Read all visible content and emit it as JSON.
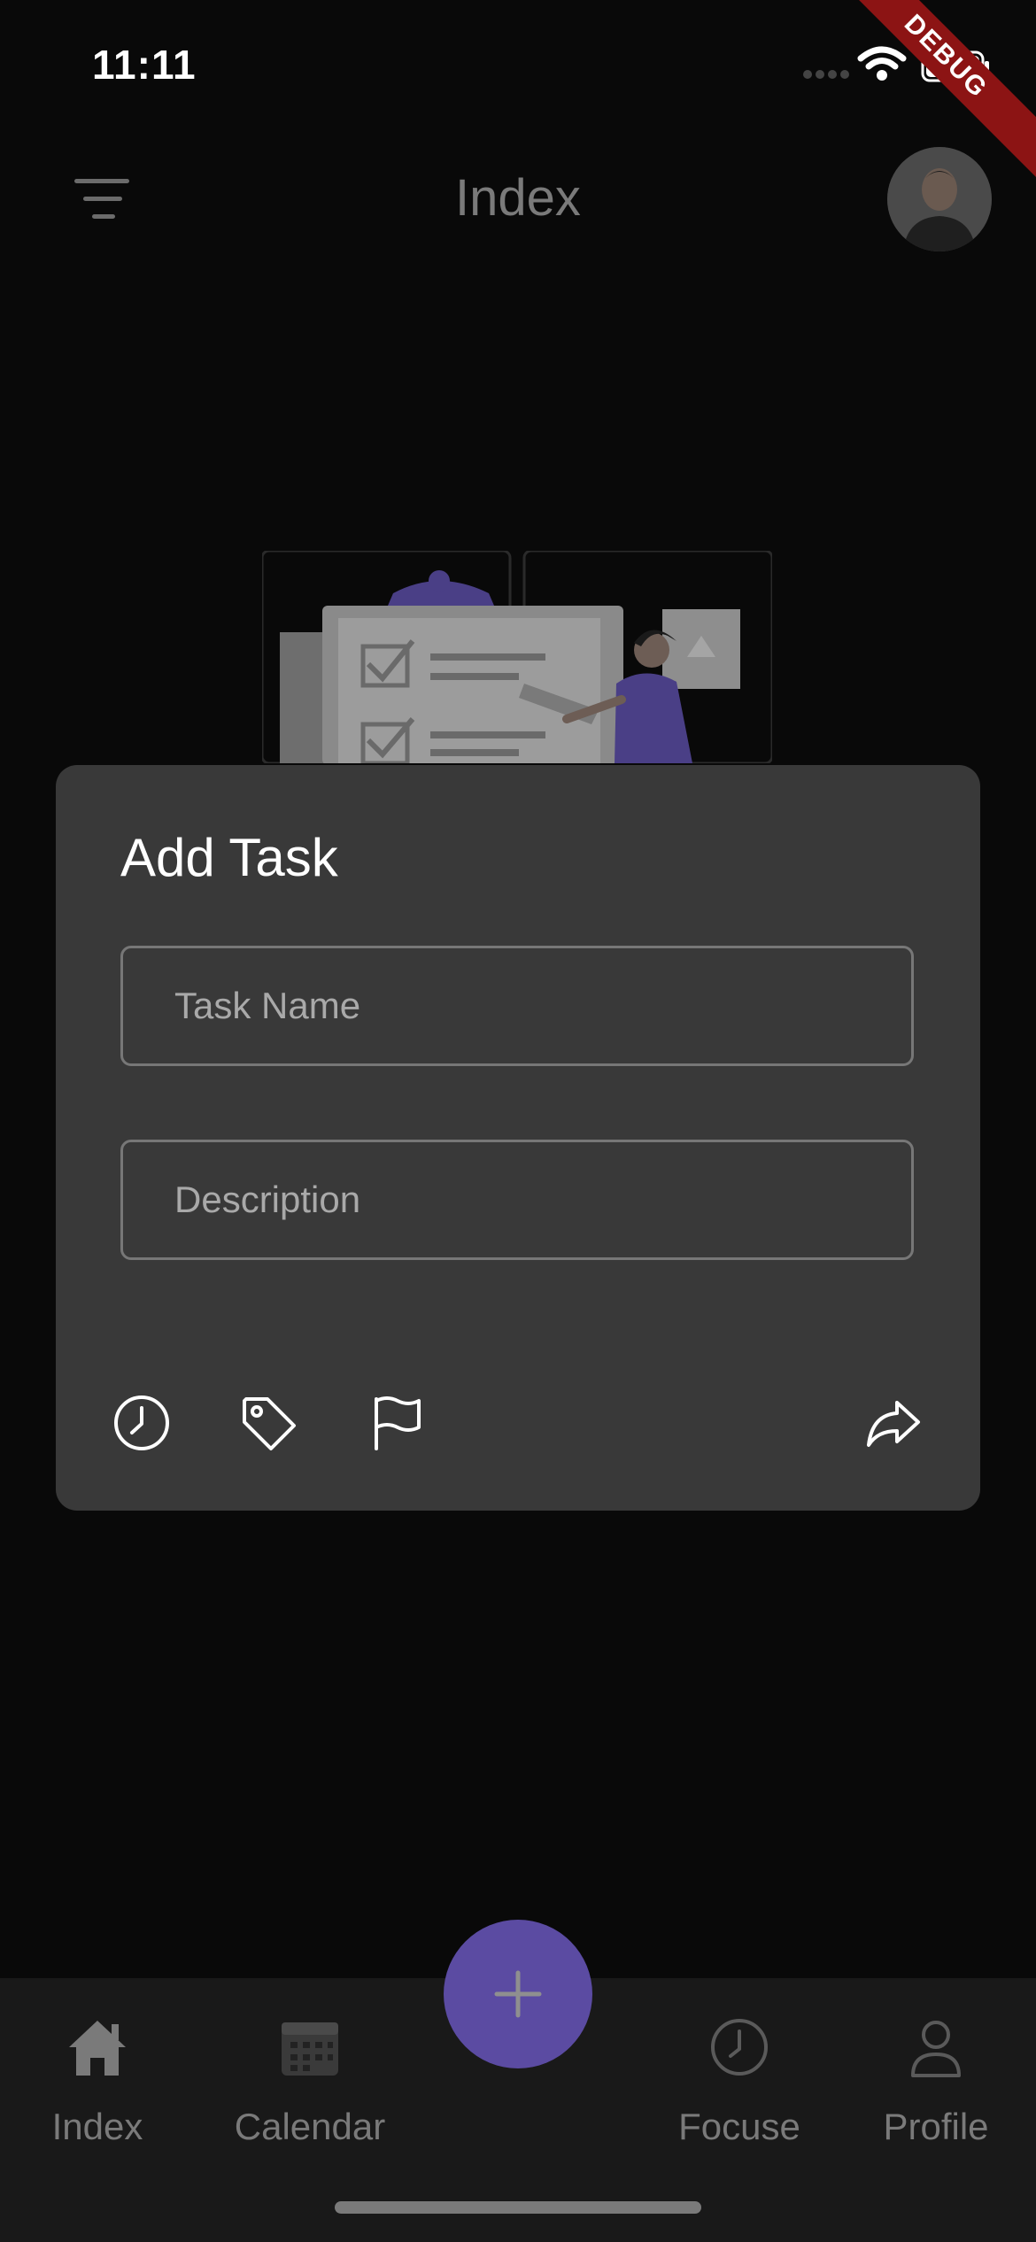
{
  "status_bar": {
    "time": "11:11",
    "debug_label": "DEBUG"
  },
  "app_bar": {
    "title": "Index"
  },
  "add_task": {
    "title": "Add Task",
    "task_name_placeholder": "Task Name",
    "description_placeholder": "Description",
    "icons": [
      "clock-icon",
      "tag-icon",
      "flag-icon",
      "send-icon"
    ]
  },
  "bottom_nav": {
    "items": [
      {
        "label": "Index",
        "icon": "home-icon"
      },
      {
        "label": "Calendar",
        "icon": "calendar-icon"
      },
      {
        "label": "Focuse",
        "icon": "clock-icon"
      },
      {
        "label": "Profile",
        "icon": "user-icon"
      }
    ],
    "fab_icon": "plus-icon"
  },
  "colors": {
    "accent": "#5b4ba2",
    "sheet": "#393939",
    "background": "#090909",
    "nav": "#191919"
  }
}
